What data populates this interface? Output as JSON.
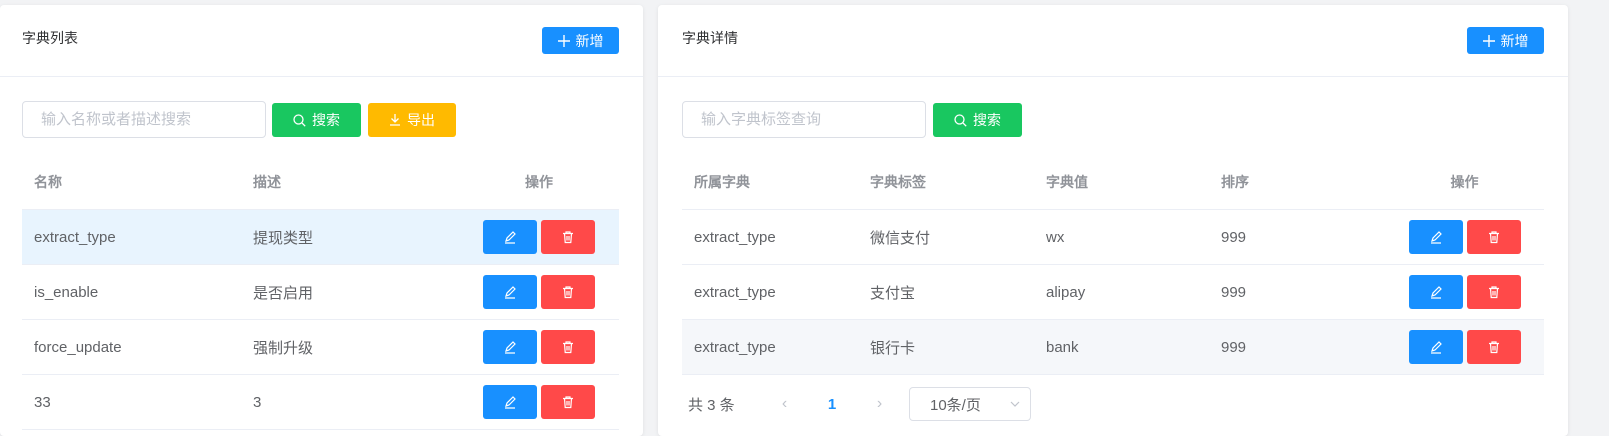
{
  "left": {
    "title": "字典列表",
    "add_label": "新增",
    "search": {
      "placeholder": "输入名称或者描述搜索",
      "value": ""
    },
    "search_label": "搜索",
    "export_label": "导出",
    "columns": [
      "名称",
      "描述",
      "操作"
    ],
    "rows": [
      {
        "name": "extract_type",
        "desc": "提现类型"
      },
      {
        "name": "is_enable",
        "desc": "是否启用"
      },
      {
        "name": "force_update",
        "desc": "强制升级"
      },
      {
        "name": "33",
        "desc": "3"
      }
    ]
  },
  "right": {
    "title": "字典详情",
    "add_label": "新增",
    "search": {
      "placeholder": "输入字典标签查询",
      "value": ""
    },
    "search_label": "搜索",
    "columns": [
      "所属字典",
      "字典标签",
      "字典值",
      "排序",
      "操作"
    ],
    "rows": [
      {
        "dict": "extract_type",
        "label": "微信支付",
        "value": "wx",
        "sort": "999"
      },
      {
        "dict": "extract_type",
        "label": "支付宝",
        "value": "alipay",
        "sort": "999"
      },
      {
        "dict": "extract_type",
        "label": "银行卡",
        "value": "bank",
        "sort": "999"
      }
    ],
    "pager": {
      "total": "共 3 条",
      "current": "1",
      "size": "10条/页"
    }
  },
  "colors": {
    "primary": "#1890ff",
    "success": "#19c760",
    "warning": "#ffba00",
    "danger": "#ff4949"
  }
}
